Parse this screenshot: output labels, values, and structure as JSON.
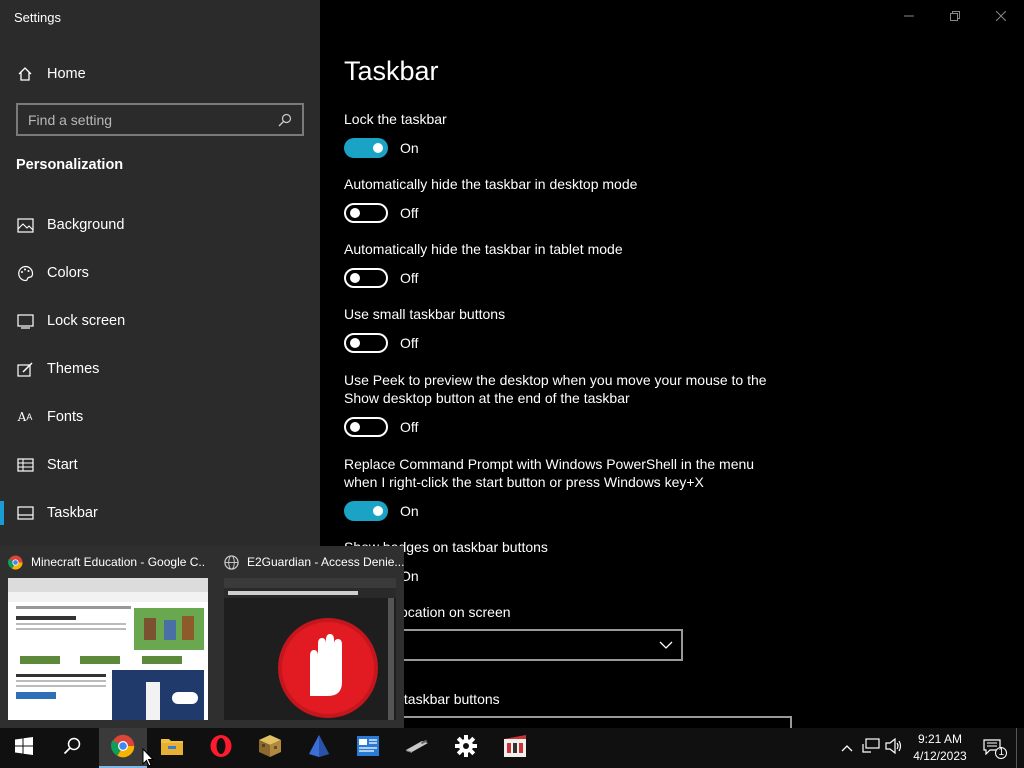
{
  "window": {
    "title": "Settings"
  },
  "sidebar": {
    "home_label": "Home",
    "search_placeholder": "Find a setting",
    "section_title": "Personalization",
    "items": [
      {
        "label": "Background",
        "icon": "picture-icon"
      },
      {
        "label": "Colors",
        "icon": "palette-icon"
      },
      {
        "label": "Lock screen",
        "icon": "lock-screen-icon"
      },
      {
        "label": "Themes",
        "icon": "brush-icon"
      },
      {
        "label": "Fonts",
        "icon": "font-icon"
      },
      {
        "label": "Start",
        "icon": "start-icon"
      },
      {
        "label": "Taskbar",
        "icon": "taskbar-icon",
        "active": true
      }
    ]
  },
  "main": {
    "title": "Taskbar",
    "settings": [
      {
        "label": "Lock the taskbar",
        "state": "On"
      },
      {
        "label": "Automatically hide the taskbar in desktop mode",
        "state": "Off"
      },
      {
        "label": "Automatically hide the taskbar in tablet mode",
        "state": "Off"
      },
      {
        "label": "Use small taskbar buttons",
        "state": "Off"
      },
      {
        "label": "Use Peek to preview the desktop when you move your mouse to the Show desktop button at the end of the taskbar",
        "state": "Off"
      },
      {
        "label": "Replace Command Prompt with Windows PowerShell in the menu when I right-click the start button or press Windows key+X",
        "state": "On"
      },
      {
        "label": "Show badges on taskbar buttons",
        "state": "On"
      }
    ],
    "location_label": "Taskbar location on screen",
    "combine_label": "Combine taskbar buttons"
  },
  "thumbnails": [
    {
      "title": "Minecraft Education - Google C...",
      "icon": "chrome-icon"
    },
    {
      "title": "E2Guardian - Access Denie...",
      "icon": "globe-icon"
    }
  ],
  "taskbar": {
    "apps": [
      "chrome-icon",
      "file-explorer-icon",
      "opera-icon",
      "minecraft-icon",
      "app-icon",
      "mail-icon",
      "usb-icon",
      "settings-gear-icon",
      "video-editor-icon"
    ]
  },
  "clock": {
    "time": "9:21 AM",
    "date": "4/12/2023"
  },
  "notifications": {
    "count": "1"
  },
  "colors": {
    "accent": "#1aa3c4",
    "sidebar_bg": "#2b2b2b",
    "main_bg": "#000000"
  }
}
